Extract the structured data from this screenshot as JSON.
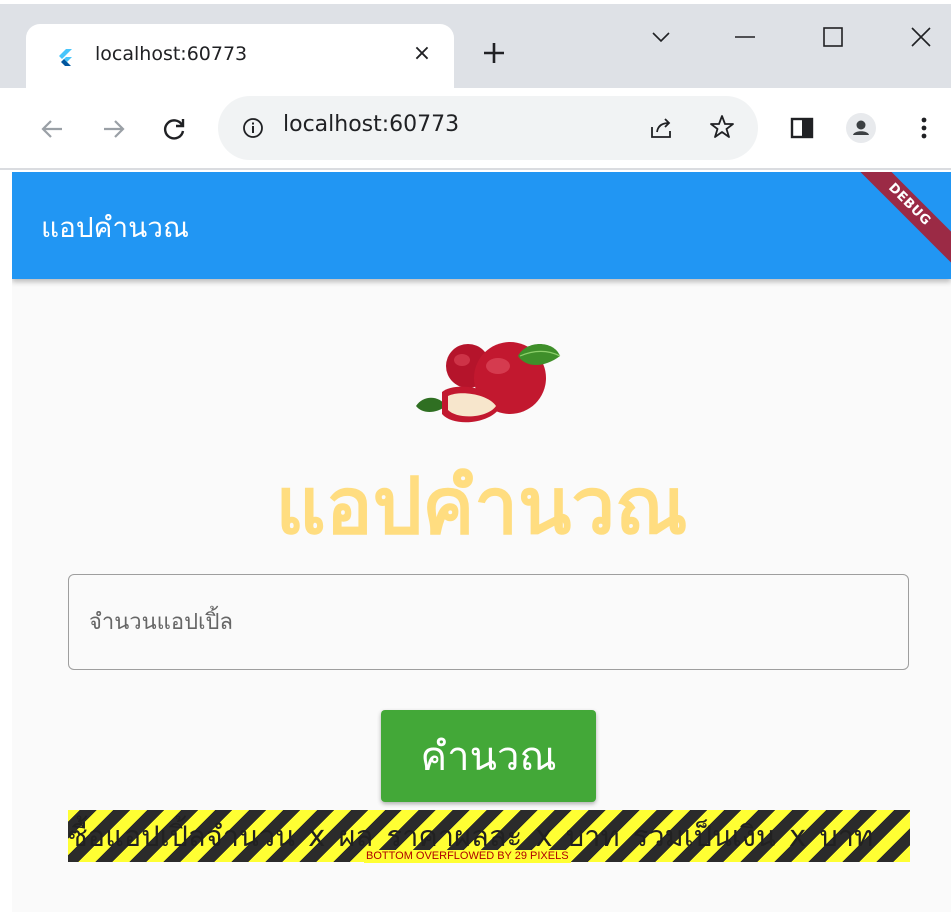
{
  "browser": {
    "tab_title": "localhost:60773",
    "tab_close": "×",
    "url": "localhost:60773",
    "icons": [
      "flutter-favicon-icon",
      "close-icon",
      "plus-icon",
      "chevron-down-icon",
      "minimize-icon",
      "maximize-icon",
      "window-close-icon",
      "back-arrow-icon",
      "forward-arrow-icon",
      "reload-icon",
      "info-icon",
      "share-icon",
      "star-icon",
      "side-panel-icon",
      "profile-icon",
      "more-vert-icon"
    ]
  },
  "app": {
    "appbar_title": "แอปคำนวณ",
    "debug_banner": "DEBUG",
    "hero_title": "แอปคำนวณ",
    "input_placeholder": "จำนวนแอปเปิ้ล",
    "calculate_button": "คำนวณ",
    "result_text": "ซื้อแอปเปิ้ลจำนวน x ผล ราคาผลละ x บาท รวมเป็นเงิน x บาท",
    "overflow_label": "BOTTOM OVERFLOWED BY 29 PIXELS"
  },
  "colors": {
    "appbar": "#2196f3",
    "hero_title": "#ffdd80",
    "button": "#43a838",
    "debug_banner": "#9b2a45"
  }
}
